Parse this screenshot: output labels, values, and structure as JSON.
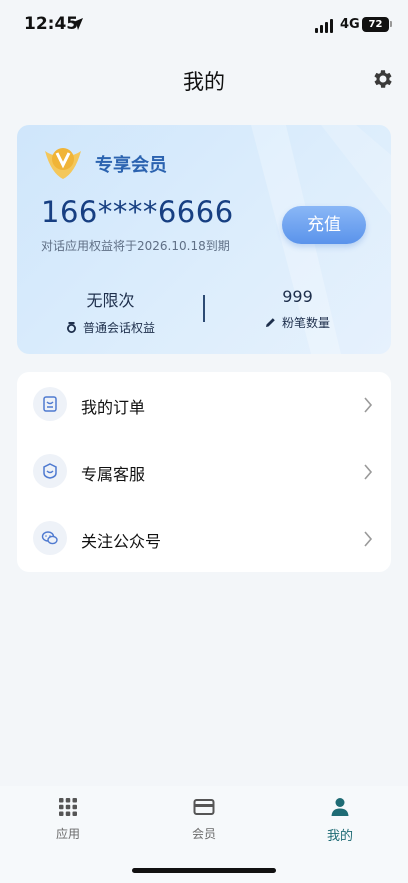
{
  "status_bar": {
    "time": "12:45",
    "network": "4G",
    "battery": "72"
  },
  "header": {
    "title": "我的"
  },
  "member_card": {
    "title": "专享会员",
    "phone": "166****6666",
    "expiry_text": "对话应用权益将于2026.10.18到期",
    "recharge_label": "充值",
    "stats": [
      {
        "value": "无限次",
        "label": "普通会话权益",
        "icon": "medal-icon"
      },
      {
        "value": "999",
        "label": "粉笔数量",
        "icon": "pencil-icon"
      }
    ]
  },
  "menu": {
    "items": [
      {
        "label": "我的订单",
        "icon": "order-icon"
      },
      {
        "label": "专属客服",
        "icon": "customer-service-icon"
      },
      {
        "label": "关注公众号",
        "icon": "wechat-icon"
      }
    ]
  },
  "tabbar": {
    "items": [
      {
        "label": "应用",
        "icon": "grid-icon",
        "active": false
      },
      {
        "label": "会员",
        "icon": "card-icon",
        "active": false
      },
      {
        "label": "我的",
        "icon": "person-icon",
        "active": true
      }
    ]
  },
  "colors": {
    "accent": "#1e6b74",
    "card_title": "#2b63b0",
    "button": "#6a9ff0"
  }
}
